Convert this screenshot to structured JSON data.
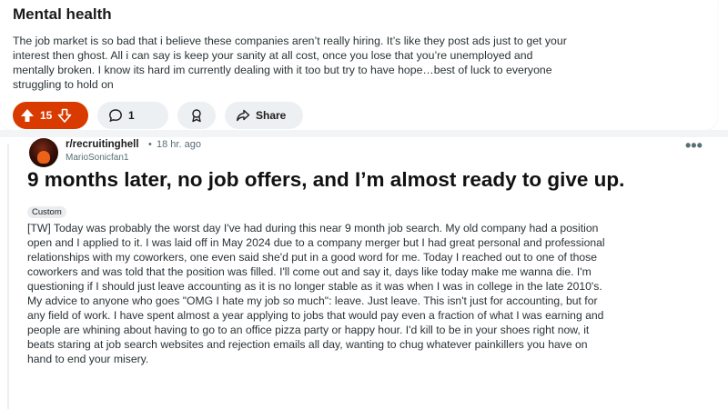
{
  "post1": {
    "title": "Mental health",
    "body_lines": [
      "The job market is so bad that i believe these companies aren’t really hiring. It’s like they post ads just to get your",
      "interest then ghost. All i can say is keep your sanity at all cost, once you lose that you’re unemployed and",
      "mentally broken. I know its hard im currently dealing with it too but try to have hope…best of luck to everyone",
      "struggling to hold on"
    ],
    "actions": {
      "vote_count": "15",
      "comment_count": "1",
      "share_label": "Share"
    },
    "icons": {
      "upvote": "upvote-icon",
      "downvote": "downvote-icon",
      "comment": "comment-icon",
      "award": "award-icon",
      "share": "share-icon"
    },
    "colors": {
      "upvote_active": "#d93a00"
    }
  },
  "post2": {
    "subreddit": "r/recruitinghell",
    "separator": "•",
    "time": "18 hr. ago",
    "username": "MarioSonicfan1",
    "more_label": "•••",
    "title": "9 months later, no job offers, and I’m almost ready to give up.",
    "flair": "Custom",
    "body_lines": [
      "[TW] Today was probably the worst day I've had during this near 9 month job search. My old company had a position",
      "open and I applied to it. I was laid off in May 2024 due to a company merger but I had great personal and professional",
      "relationships with my coworkers, one even said she'd put in a good word for me. Today I reached out to one of those",
      "coworkers and was told that the position was filled. I'll come out and say it, days like today make me wanna die. I'm",
      "questioning if I should just leave accounting as it is no longer stable as it was when I was in college in the late 2010's.",
      "My advice to anyone who goes \"OMG I hate my job so much\": leave. Just leave. This isn't just for accounting, but for",
      "any field of work. I have spent almost a year applying to jobs that would pay even a fraction of what I was earning and",
      "people are whining about having to go to an office pizza party or happy hour. I'd kill to be in your shoes right now, it",
      "beats staring at job search websites and rejection emails all day, wanting to chug whatever painkillers you have on",
      "hand to end your misery."
    ]
  }
}
